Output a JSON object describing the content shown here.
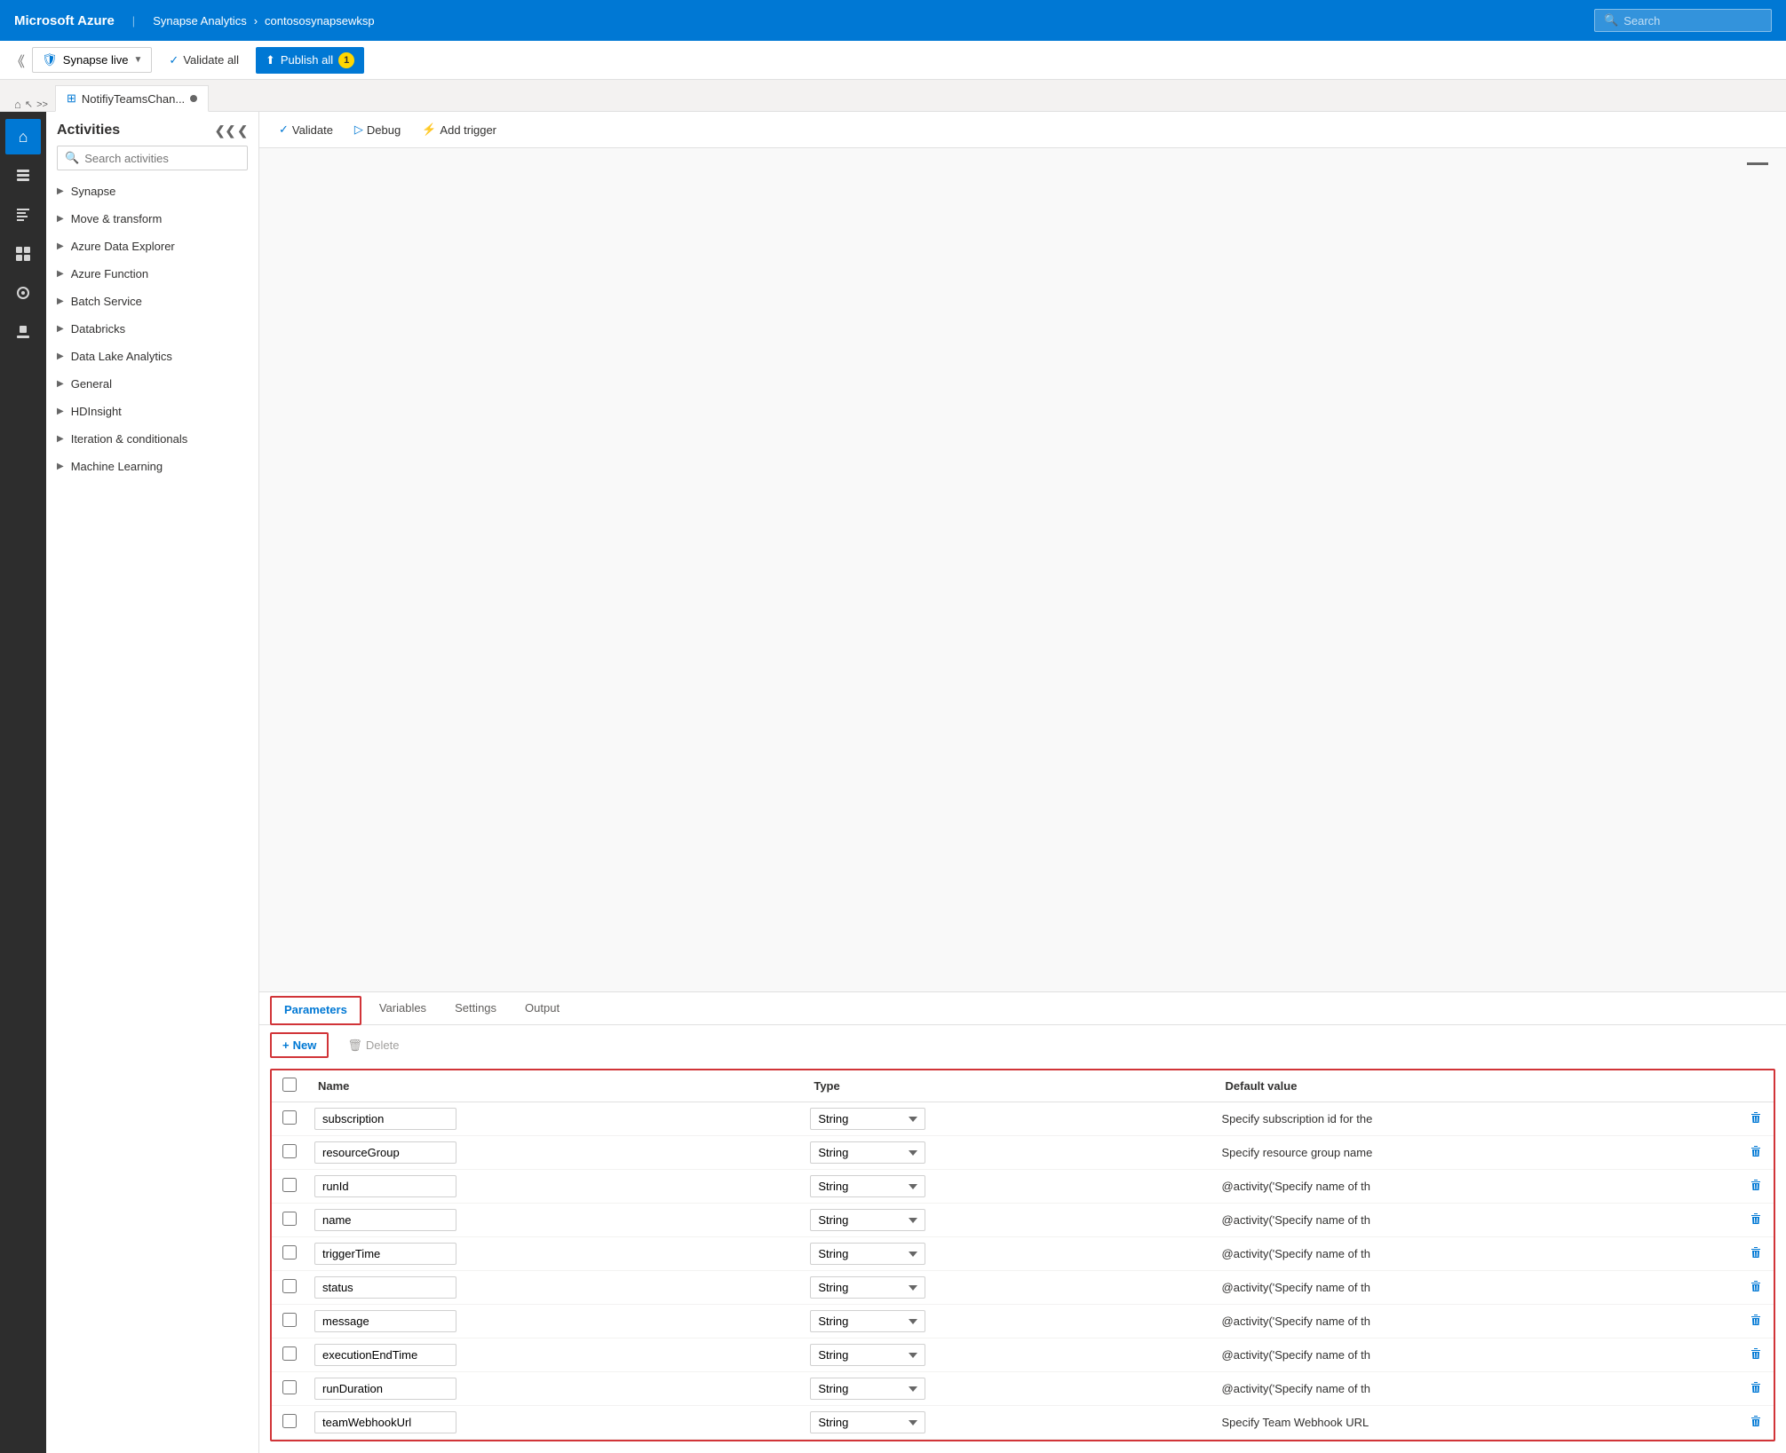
{
  "topbar": {
    "brand": "Microsoft Azure",
    "separator": "|",
    "breadcrumb1": "Synapse Analytics",
    "breadcrumb_arrow": "›",
    "breadcrumb2": "contososynapsewksp",
    "search_placeholder": "Search"
  },
  "second_toolbar": {
    "synapse_live_label": "Synapse live",
    "validate_label": "Validate all",
    "publish_label": "Publish all",
    "publish_badge": "1"
  },
  "tab_bar": {
    "tab_label": "NotifiyTeamsChan...",
    "tab_dot": true
  },
  "icon_sidebar": {
    "items": [
      {
        "name": "home-icon",
        "icon": "⌂",
        "active": true
      },
      {
        "name": "data-icon",
        "icon": "🗄",
        "active": false
      },
      {
        "name": "document-icon",
        "icon": "📄",
        "active": false
      },
      {
        "name": "pipeline-icon",
        "icon": "⊞",
        "active": false
      },
      {
        "name": "monitor-icon",
        "icon": "◉",
        "active": false
      },
      {
        "name": "toolkit-icon",
        "icon": "🧰",
        "active": false
      }
    ]
  },
  "activities": {
    "title": "Activities",
    "search_placeholder": "Search activities",
    "groups": [
      {
        "label": "Synapse"
      },
      {
        "label": "Move & transform"
      },
      {
        "label": "Azure Data Explorer"
      },
      {
        "label": "Azure Function"
      },
      {
        "label": "Batch Service"
      },
      {
        "label": "Databricks"
      },
      {
        "label": "Data Lake Analytics"
      },
      {
        "label": "General"
      },
      {
        "label": "HDInsight"
      },
      {
        "label": "Iteration & conditionals"
      },
      {
        "label": "Machine Learning"
      }
    ]
  },
  "canvas_toolbar": {
    "validate_label": "Validate",
    "debug_label": "Debug",
    "add_trigger_label": "Add trigger"
  },
  "params_panel": {
    "tabs": [
      {
        "label": "Parameters",
        "active": true
      },
      {
        "label": "Variables",
        "active": false
      },
      {
        "label": "Settings",
        "active": false
      },
      {
        "label": "Output",
        "active": false
      }
    ],
    "new_button": "New",
    "delete_button": "Delete",
    "columns": {
      "checkbox": "",
      "name": "Name",
      "type": "Type",
      "default_value": "Default value"
    },
    "rows": [
      {
        "name": "subscription",
        "type": "String",
        "default_value": "Specify subscription id for the"
      },
      {
        "name": "resourceGroup",
        "type": "String",
        "default_value": "Specify resource group name"
      },
      {
        "name": "runId",
        "type": "String",
        "default_value": "@activity('Specify name of th"
      },
      {
        "name": "name",
        "type": "String",
        "default_value": "@activity('Specify name of th"
      },
      {
        "name": "triggerTime",
        "type": "String",
        "default_value": "@activity('Specify name of th"
      },
      {
        "name": "status",
        "type": "String",
        "default_value": "@activity('Specify name of th"
      },
      {
        "name": "message",
        "type": "String",
        "default_value": "@activity('Specify name of th"
      },
      {
        "name": "executionEndTime",
        "type": "String",
        "default_value": "@activity('Specify name of th"
      },
      {
        "name": "runDuration",
        "type": "String",
        "default_value": "@activity('Specify name of th"
      },
      {
        "name": "teamWebhookUrl",
        "type": "String",
        "default_value": "Specify Team Webhook URL"
      }
    ]
  }
}
